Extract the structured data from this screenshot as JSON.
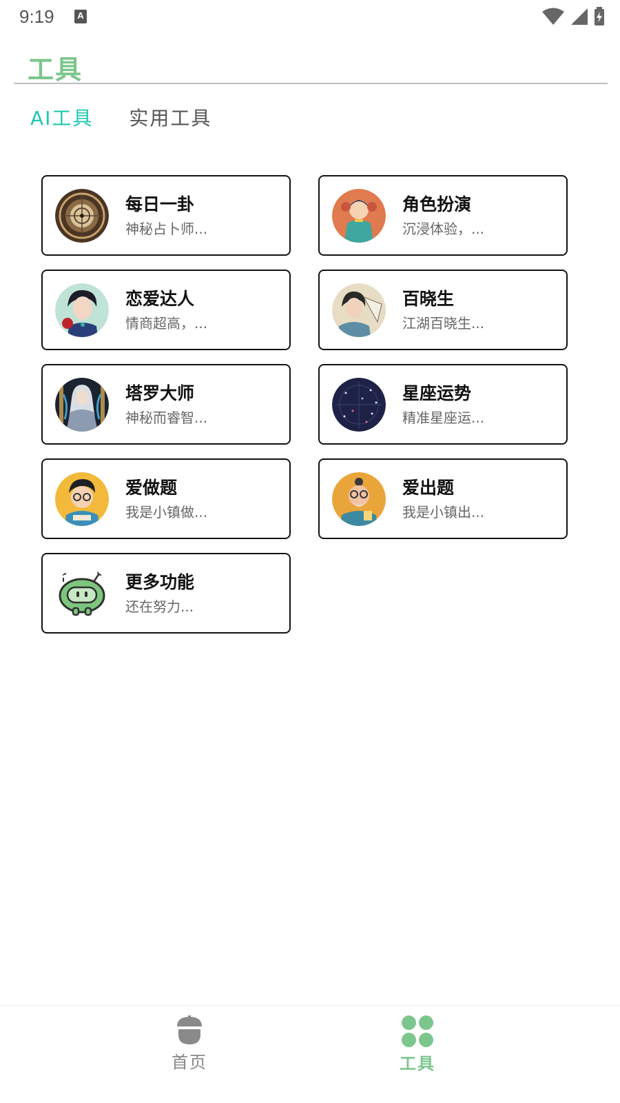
{
  "status_bar": {
    "time": "9:19",
    "notification_icon": "a-keyboard-icon",
    "icons": [
      "wifi-icon",
      "signal-icon",
      "battery-charging-icon"
    ]
  },
  "header": {
    "title": "工具"
  },
  "tabs": [
    {
      "label": "AI工具",
      "active": true
    },
    {
      "label": "实用工具",
      "active": false
    }
  ],
  "cards": [
    {
      "title": "每日一卦",
      "desc": "神秘占卜师...",
      "avatar": "compass-avatar"
    },
    {
      "title": "角色扮演",
      "desc": "沉浸体验，...",
      "avatar": "role-play-avatar"
    },
    {
      "title": "恋爱达人",
      "desc": "情商超高，...",
      "avatar": "romance-avatar"
    },
    {
      "title": "百晓生",
      "desc": "江湖百晓生...",
      "avatar": "scholar-avatar"
    },
    {
      "title": "塔罗大师",
      "desc": "神秘而睿智...",
      "avatar": "tarot-avatar"
    },
    {
      "title": "星座运势",
      "desc": "精准星座运...",
      "avatar": "star-map-avatar"
    },
    {
      "title": "爱做题",
      "desc": "我是小镇做...",
      "avatar": "student-avatar"
    },
    {
      "title": "爱出题",
      "desc": "我是小镇出...",
      "avatar": "teacher-avatar"
    },
    {
      "title": "更多功能",
      "desc": "还在努力...",
      "avatar": "robot-avatar"
    }
  ],
  "bottom_nav": {
    "home_label": "首页",
    "tools_label": "工具",
    "active": "tools"
  },
  "colors": {
    "brand_green": "#7cc68d",
    "tab_active": "#1fc7b0"
  }
}
